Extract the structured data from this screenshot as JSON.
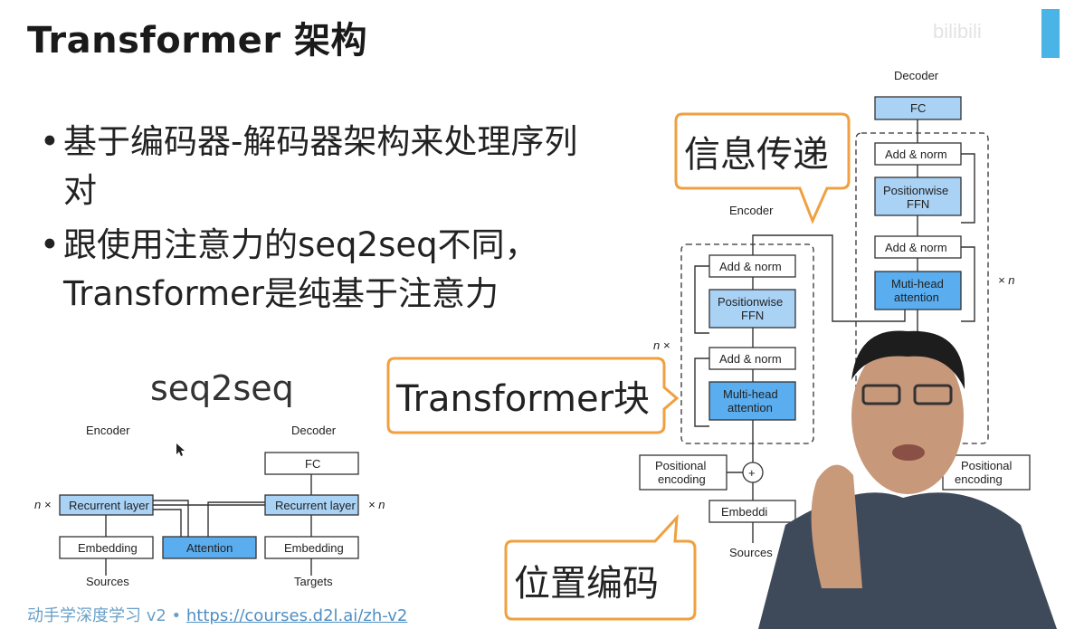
{
  "slide": {
    "title": "Transformer 架构",
    "bullets": [
      "基于编码器-解码器架构来处理序列对",
      "跟使用注意力的seq2seq不同，Transformer是纯基于注意力"
    ],
    "bullet_symbol": "•",
    "left_diagram_title": "seq2seq"
  },
  "seq2seq_diagram": {
    "encoder_label": "Encoder",
    "decoder_label": "Decoder",
    "recurrent_layer": "Recurrent layer",
    "embedding": "Embedding",
    "attention": "Attention",
    "fc": "FC",
    "sources": "Sources",
    "targets": "Targets",
    "n_times_left": "n ×",
    "n_times_right": "× n"
  },
  "transformer_diagram": {
    "encoder_label": "Encoder",
    "decoder_label": "Decoder",
    "fc": "FC",
    "add_norm": "Add & norm",
    "positionwise": "Positionwise",
    "ffn": "FFN",
    "multi_head": "Multi-head",
    "muti_head": "Muti-head",
    "attention": "attention",
    "positional": "Positional",
    "encoding": "encoding",
    "embedding": "Embeddi",
    "sources": "Sources",
    "n_times_left": "n ×",
    "n_times_right": "× n",
    "plus": "+"
  },
  "callouts": {
    "info_transfer": "信息传递",
    "transformer_block": "Transformer块",
    "position_encoding": "位置编码"
  },
  "footer": {
    "prefix": "动手学深度学习 v2 • ",
    "link": "https://courses.d2l.ai/zh-v2"
  },
  "colors": {
    "accent_orange": "#f0a040",
    "box_light_blue": "#a9d2f5",
    "box_blue": "#5aaef0",
    "footer_link": "#4f8fc4"
  }
}
